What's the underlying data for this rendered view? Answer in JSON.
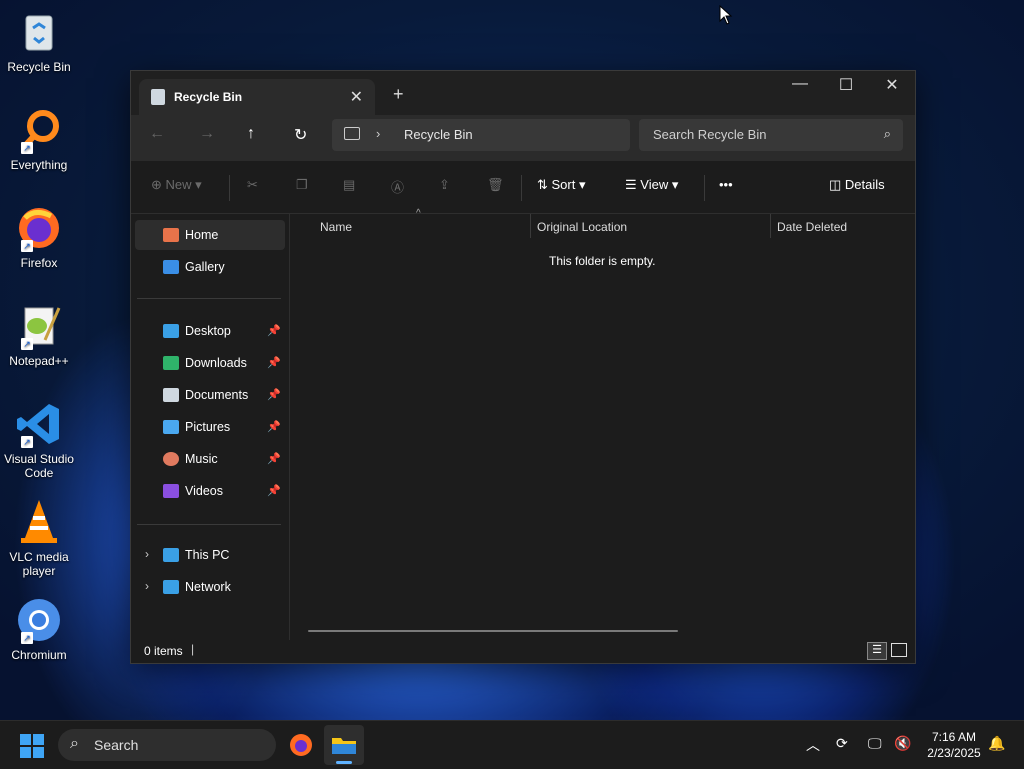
{
  "desktop": {
    "icons": [
      {
        "label": "Recycle Bin"
      },
      {
        "label": "Everything"
      },
      {
        "label": "Firefox"
      },
      {
        "label": "Notepad++"
      },
      {
        "label": "Visual Studio Code"
      },
      {
        "label": "VLC media player"
      },
      {
        "label": "Chromium"
      }
    ]
  },
  "window": {
    "tab_title": "Recycle Bin",
    "tab_close": "✕",
    "new_tab": "+",
    "minimize": "—",
    "maximize": "☐",
    "close": "✕"
  },
  "nav": {
    "back": "←",
    "forward": "→",
    "up": "↑",
    "refresh": "↻",
    "breadcrumb": "Recycle Bin",
    "breadcrumb_sep": "›",
    "search_placeholder": "Search Recycle Bin",
    "search_icon": "⌕"
  },
  "toolbar": {
    "new_label": "New",
    "sort_label": "Sort",
    "view_label": "View",
    "more_label": "•••",
    "details_label": "Details"
  },
  "sidebar": {
    "items": [
      {
        "label": "Home",
        "icon": "home-icon",
        "color": "#e8734a"
      },
      {
        "label": "Gallery",
        "icon": "gallery-icon",
        "color": "#3a8ee6"
      },
      {
        "label": "Desktop",
        "icon": "desktop-icon",
        "color": "#3aa0e6"
      },
      {
        "label": "Downloads",
        "icon": "download-icon",
        "color": "#2fb36a"
      },
      {
        "label": "Documents",
        "icon": "document-icon",
        "color": "#cfd8e0"
      },
      {
        "label": "Pictures",
        "icon": "pictures-icon",
        "color": "#4aa8f0"
      },
      {
        "label": "Music",
        "icon": "music-icon",
        "color": "#e07a5f"
      },
      {
        "label": "Videos",
        "icon": "videos-icon",
        "color": "#8a4fe0"
      },
      {
        "label": "This PC",
        "icon": "pc-icon",
        "color": "#3aa0e6"
      },
      {
        "label": "Network",
        "icon": "network-icon",
        "color": "#3aa0e6"
      }
    ]
  },
  "content": {
    "columns": [
      "Name",
      "Original Location",
      "Date Deleted"
    ],
    "empty_message": "This folder is empty.",
    "sort_caret": "^"
  },
  "status": {
    "item_count": "0 items"
  },
  "taskbar": {
    "search_placeholder": "Search",
    "time": "7:16 AM",
    "date": "2/23/2025"
  }
}
